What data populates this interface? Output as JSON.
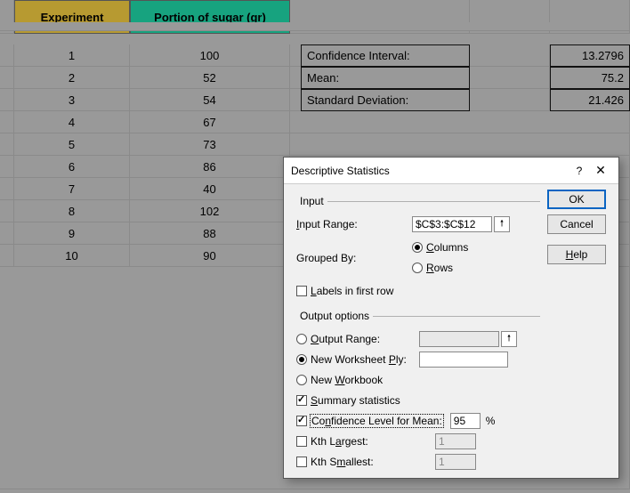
{
  "headers": {
    "experiment": "Experiment",
    "portion": "Portion of sugar (gr)"
  },
  "data_rows": [
    {
      "exp": "1",
      "val": "100"
    },
    {
      "exp": "2",
      "val": "52"
    },
    {
      "exp": "3",
      "val": "54"
    },
    {
      "exp": "4",
      "val": "67"
    },
    {
      "exp": "5",
      "val": "73"
    },
    {
      "exp": "6",
      "val": "86"
    },
    {
      "exp": "7",
      "val": "40"
    },
    {
      "exp": "8",
      "val": "102"
    },
    {
      "exp": "9",
      "val": "88"
    },
    {
      "exp": "10",
      "val": "90"
    }
  ],
  "stats": [
    {
      "label": "Confidence Interval:",
      "value": "13.2796"
    },
    {
      "label": "Mean:",
      "value": "75.2"
    },
    {
      "label": "Standard Deviation:",
      "value": "21.426"
    }
  ],
  "dialog": {
    "title": "Descriptive Statistics",
    "help_symbol": "?",
    "close_symbol": "✕",
    "input_legend": "Input",
    "input_range_label": "Input Range:",
    "input_range_value": "$C$3:$C$12",
    "grouped_by_label": "Grouped By:",
    "grouped_columns": "Columns",
    "grouped_rows": "Rows",
    "labels_first_row": "Labels in first row",
    "output_legend": "Output options",
    "output_range": "Output Range:",
    "new_ws_ply": "New Worksheet Ply:",
    "new_wb": "New Workbook",
    "summary_stats": "Summary statistics",
    "conf_level": "Confidence Level for Mean:",
    "conf_value": "95",
    "percent": "%",
    "kth_largest": "Kth Largest:",
    "kth_smallest": "Kth Smallest:",
    "kth_val": "1",
    "ok": "OK",
    "cancel": "Cancel",
    "help": "Help"
  }
}
